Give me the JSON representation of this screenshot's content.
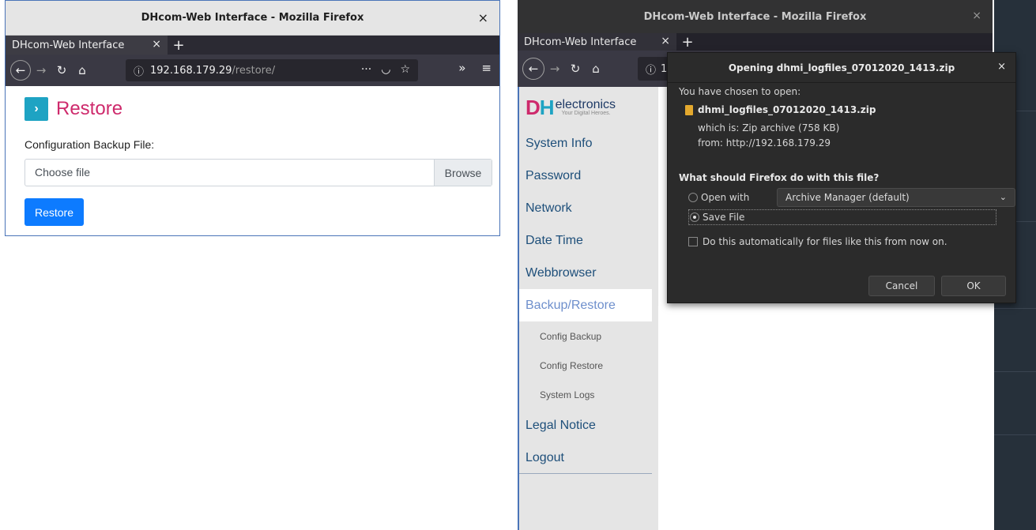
{
  "windowA": {
    "title": "DHcom-Web Interface - Mozilla Firefox",
    "tab_label": "DHcom-Web Interface",
    "url_host": "192.168.179.29",
    "url_path": "/restore/",
    "page": {
      "heading": "Restore",
      "field_label": "Configuration Backup File:",
      "file_placeholder": "Choose file",
      "browse_label": "Browse",
      "restore_button": "Restore"
    }
  },
  "windowB": {
    "title": "DHcom-Web Interface - Mozilla Firefox",
    "tab_label": "DHcom-Web Interface",
    "url_stub": "1",
    "brand": {
      "name": "electronics",
      "tagline": "Your Digital Heroes."
    },
    "menu": [
      {
        "label": "System Info"
      },
      {
        "label": "Password"
      },
      {
        "label": "Network"
      },
      {
        "label": "Date Time"
      },
      {
        "label": "Webbrowser"
      },
      {
        "label": "Backup/Restore"
      }
    ],
    "submenu": [
      {
        "label": "Config Backup"
      },
      {
        "label": "Config Restore"
      },
      {
        "label": "System Logs"
      }
    ],
    "menu_after": [
      {
        "label": "Legal Notice"
      },
      {
        "label": "Logout"
      }
    ]
  },
  "dialog": {
    "title": "Opening dhmi_logfiles_07012020_1413.zip",
    "chosen_text": "You have chosen to open:",
    "file_name": "dhmi_logfiles_07012020_1413.zip",
    "which_is": "which is: Zip archive (758 KB)",
    "from": "from: http://192.168.179.29",
    "question": "What should Firefox do with this file?",
    "open_with_label": "Open with",
    "open_with_app": "Archive Manager (default)",
    "save_file_label": "Save File",
    "auto_label": "Do this automatically for files like this from now on.",
    "cancel_label": "Cancel",
    "ok_label": "OK"
  }
}
